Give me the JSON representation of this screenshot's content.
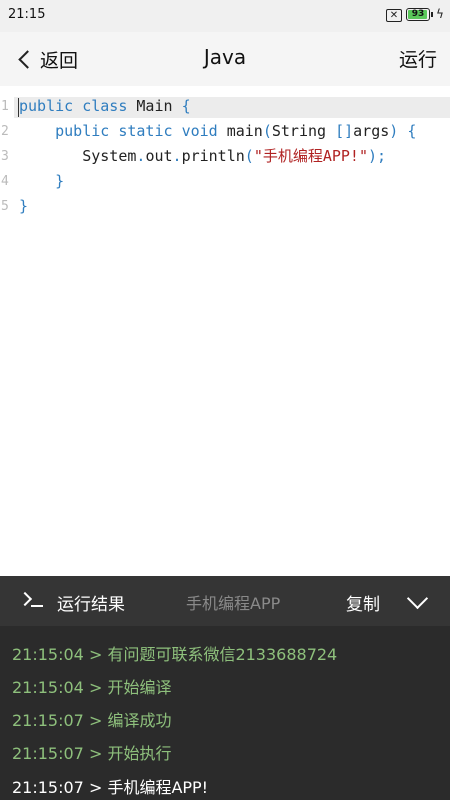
{
  "status_bar": {
    "time": "21:15",
    "sim_icon_text": "✕",
    "battery_level": "93",
    "battery_fraction": 0.93
  },
  "header": {
    "back_label": "返回",
    "title": "Java",
    "run_label": "运行"
  },
  "editor": {
    "line_numbers": [
      "1",
      "2",
      "3",
      "4",
      "5"
    ],
    "code": {
      "l1_kw1": "public",
      "l1_kw2": "class",
      "l1_name": "Main",
      "l1_brace": "{",
      "l2_kw1": "public",
      "l2_kw2": "static",
      "l2_kw3": "void",
      "l2_name": "main",
      "l2_paren_open": "(",
      "l2_type": "String",
      "l2_brackets": "[]",
      "l2_args": "args",
      "l2_paren_close": ")",
      "l2_brace": "{",
      "l3_obj": "System",
      "l3_dot1": ".",
      "l3_field": "out",
      "l3_dot2": ".",
      "l3_method": "println",
      "l3_paren_open": "(",
      "l3_string": "\"手机编程APP!\"",
      "l3_paren_close": ");",
      "l4_brace": "}",
      "l5_brace": "}"
    }
  },
  "result_bar": {
    "title": "运行结果",
    "subtitle": "手机编程APP",
    "copy_label": "复制"
  },
  "console": {
    "lines": [
      "21:15:04 > 有问题可联系微信2133688724",
      "21:15:04 > 开始编译",
      "21:15:07 > 编译成功",
      "21:15:07 > 开始执行",
      "21:15:07 > 手机编程APP!"
    ]
  },
  "colors": {
    "keyword": "#2f7dbf",
    "string": "#b02222",
    "console_info": "#8ec07c",
    "console_output": "#ffffff",
    "result_bar_bg": "#353535",
    "console_bg": "#2b2b2b"
  }
}
